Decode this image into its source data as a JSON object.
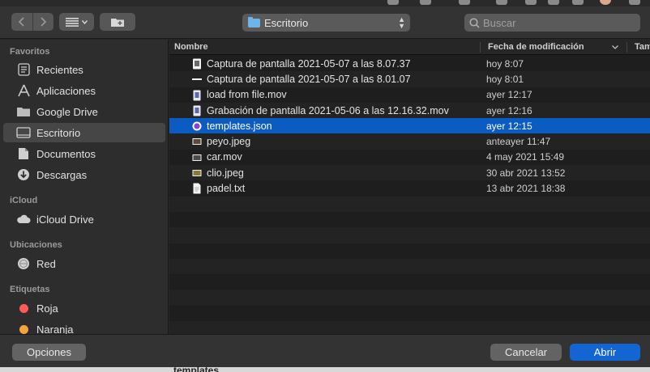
{
  "toolbar": {
    "location": "Escritorio",
    "search_placeholder": "Buscar"
  },
  "sidebar": {
    "sections": [
      {
        "title": "Favoritos"
      },
      {
        "title": "iCloud"
      },
      {
        "title": "Ubicaciones"
      },
      {
        "title": "Etiquetas"
      }
    ],
    "favorites": [
      {
        "label": "Recientes",
        "icon": "clock-icon"
      },
      {
        "label": "Aplicaciones",
        "icon": "applications-icon"
      },
      {
        "label": "Google Drive",
        "icon": "folder-icon"
      },
      {
        "label": "Escritorio",
        "icon": "desktop-icon"
      },
      {
        "label": "Documentos",
        "icon": "document-icon"
      },
      {
        "label": "Descargas",
        "icon": "download-icon"
      }
    ],
    "icloud": [
      {
        "label": "iCloud Drive",
        "icon": "cloud-icon"
      }
    ],
    "locations": [
      {
        "label": "Red",
        "icon": "network-globe-icon"
      }
    ],
    "tags": [
      {
        "label": "Roja",
        "color": "#ff5b57"
      },
      {
        "label": "Naranja",
        "color": "#f7a33c"
      }
    ]
  },
  "filelist": {
    "columns": {
      "name": "Nombre",
      "date": "Fecha de modificación",
      "size": "Tam"
    },
    "files": [
      {
        "name": "Captura de pantalla 2021-05-07 a las 8.07.37",
        "date": "hoy 8:07",
        "icon": "screenshot-file-icon"
      },
      {
        "name": "Captura de pantalla 2021-05-07 a las 8.01.07",
        "date": "hoy 8:01",
        "icon": "screenshot-file-icon"
      },
      {
        "name": "load from file.mov",
        "date": "ayer 12:17",
        "icon": "movie-file-icon"
      },
      {
        "name": "Grabación de pantalla 2021-05-06 a las 12.16.32.mov",
        "date": "ayer 12:16",
        "icon": "movie-file-icon"
      },
      {
        "name": "templates.json",
        "date": "ayer 12:15",
        "icon": "json-file-icon"
      },
      {
        "name": "peyo.jpeg",
        "date": "anteayer 11:47",
        "icon": "image-file-icon"
      },
      {
        "name": "car.mov",
        "date": "4 may 2021 15:49",
        "icon": "movie-file-icon"
      },
      {
        "name": "clio.jpeg",
        "date": "30 abr 2021 13:52",
        "icon": "image-file-icon"
      },
      {
        "name": "padel.txt",
        "date": "13 abr 2021 18:38",
        "icon": "text-file-icon"
      }
    ]
  },
  "buttons": {
    "options": "Opciones",
    "cancel": "Cancelar",
    "open": "Abrir"
  },
  "background_window": {
    "visible_text": "templates."
  },
  "colors": {
    "selection": "#0a5bc2",
    "primary_button": "#1465d4"
  }
}
